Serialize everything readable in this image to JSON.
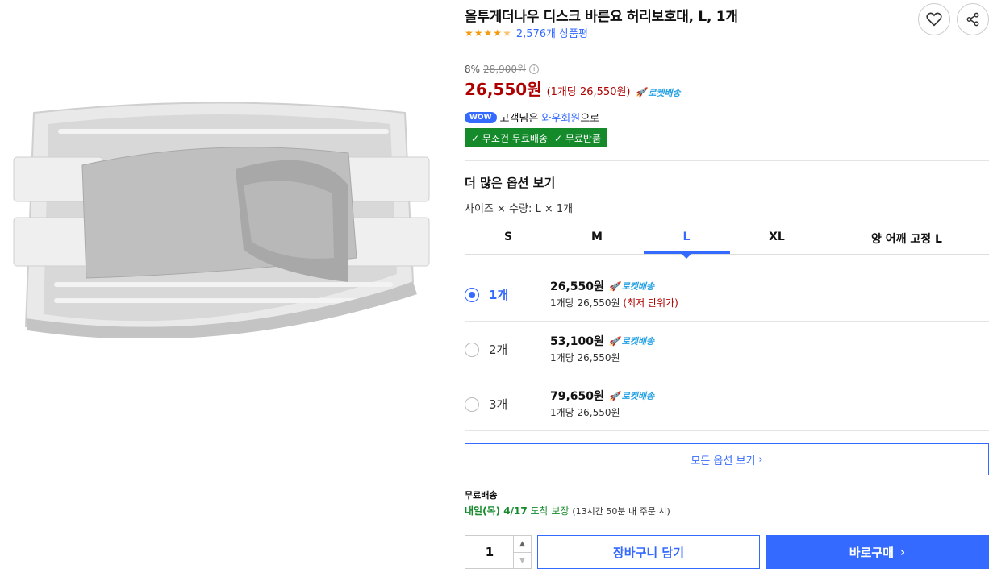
{
  "product": {
    "title": "올투게더나우 디스크 바른요 허리보호대, L, 1개",
    "rating": 4.5,
    "review_count": "2,576개 상품평"
  },
  "price": {
    "discount_rate": "8%",
    "original_price": "28,900원",
    "sale_price": "26,550원",
    "unit_price": "(1개당 26,550원)",
    "rocket_label": "로켓배송"
  },
  "membership": {
    "badge": "WOW",
    "prefix": "고객님은",
    "link": "와우회원",
    "suffix": "으로",
    "benefit_1": "✓ 무조건 무료배송",
    "benefit_2": "✓ 무료반품"
  },
  "options": {
    "heading": "더 많은 옵션 보기",
    "selection_label": "사이즈 × 수량: L × 1개",
    "size_tabs": [
      "S",
      "M",
      "L",
      "XL",
      "양 어깨 고정 L"
    ],
    "selected_tab": "L",
    "quantity_rows": [
      {
        "qty": "1개",
        "price": "26,550원",
        "unit": "1개당 26,550원",
        "note": "(최저 단위가)",
        "selected": true
      },
      {
        "qty": "2개",
        "price": "53,100원",
        "unit": "1개당 26,550원",
        "note": "",
        "selected": false
      },
      {
        "qty": "3개",
        "price": "79,650원",
        "unit": "1개당 26,550원",
        "note": "",
        "selected": false
      }
    ],
    "all_options_label": "모든 옵션 보기"
  },
  "shipping": {
    "title": "무료배송",
    "date_bold": "내일(목) 4/17",
    "date_rest": "도착 보장",
    "note": "(13시간 50분 내 주문 시)"
  },
  "purchase": {
    "quantity": "1",
    "cart_label": "장바구니 담기",
    "buy_label": "바로구매"
  },
  "colors": {
    "accent": "#346aff",
    "price_red": "#ae0000",
    "benefit_green": "#148a2b",
    "rocket_blue": "#23a0e3",
    "star_orange": "#f39c12"
  }
}
